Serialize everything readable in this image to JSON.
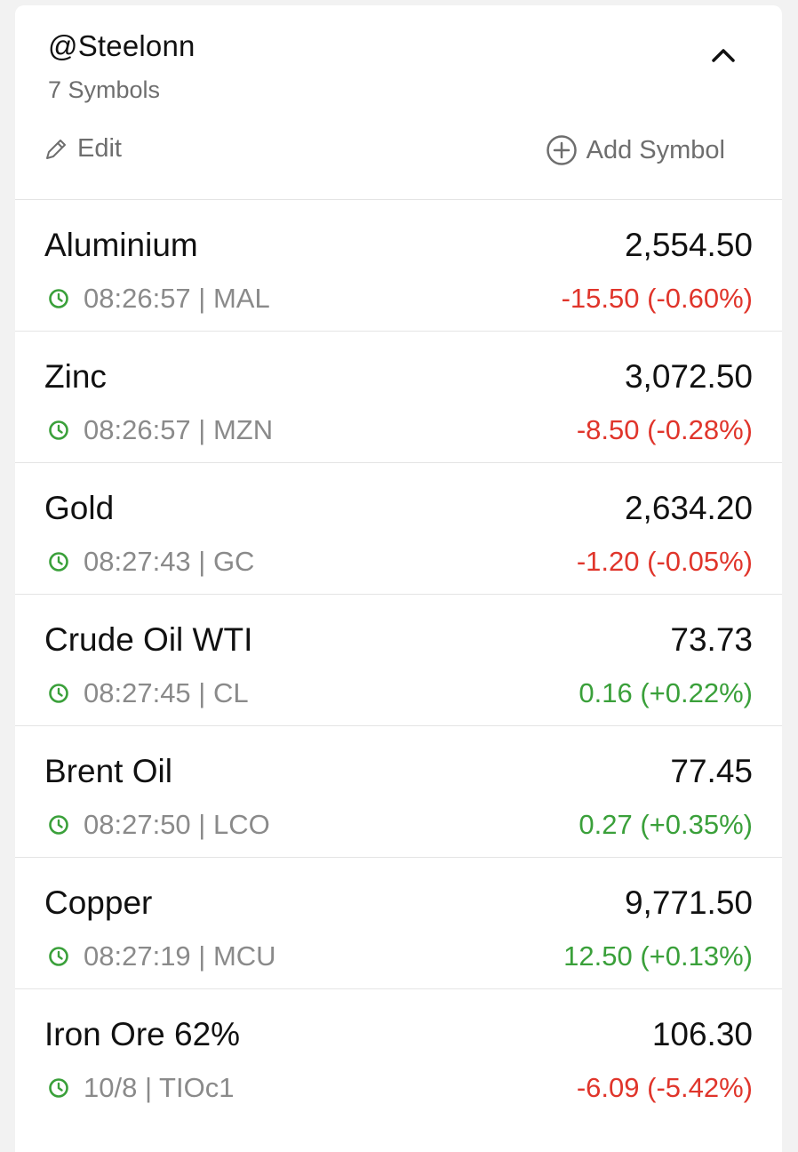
{
  "watchlist": {
    "title": "@Steelonn",
    "subtitle": "7 Symbols",
    "edit_label": "Edit",
    "add_label": "Add Symbol"
  },
  "colors": {
    "negative": "#e0352b",
    "positive": "#3aa03a",
    "clock": "#3aa03a"
  },
  "symbols": [
    {
      "name": "Aluminium",
      "price": "2,554.50",
      "time": "08:26:57",
      "ticker": "MAL",
      "meta": "08:26:57 | MAL",
      "change": "-15.50 (-0.60%)",
      "direction": "negative"
    },
    {
      "name": "Zinc",
      "price": "3,072.50",
      "time": "08:26:57",
      "ticker": "MZN",
      "meta": "08:26:57 | MZN",
      "change": "-8.50 (-0.28%)",
      "direction": "negative"
    },
    {
      "name": "Gold",
      "price": "2,634.20",
      "time": "08:27:43",
      "ticker": "GC",
      "meta": "08:27:43 | GC",
      "change": "-1.20 (-0.05%)",
      "direction": "negative"
    },
    {
      "name": "Crude Oil WTI",
      "price": "73.73",
      "time": "08:27:45",
      "ticker": "CL",
      "meta": "08:27:45 | CL",
      "change": "0.16 (+0.22%)",
      "direction": "positive"
    },
    {
      "name": "Brent Oil",
      "price": "77.45",
      "time": "08:27:50",
      "ticker": "LCO",
      "meta": "08:27:50 | LCO",
      "change": "0.27 (+0.35%)",
      "direction": "positive"
    },
    {
      "name": "Copper",
      "price": "9,771.50",
      "time": "08:27:19",
      "ticker": "MCU",
      "meta": "08:27:19 | MCU",
      "change": "12.50 (+0.13%)",
      "direction": "positive"
    },
    {
      "name": "Iron Ore 62%",
      "price": "106.30",
      "time": "10/8",
      "ticker": "TIOc1",
      "meta": "10/8 | TIOc1",
      "change": "-6.09 (-5.42%)",
      "direction": "negative"
    }
  ],
  "icons": {
    "collapse": "chevron-up-icon",
    "edit": "pencil-icon",
    "add": "plus-circle-icon",
    "time": "clock-icon"
  }
}
